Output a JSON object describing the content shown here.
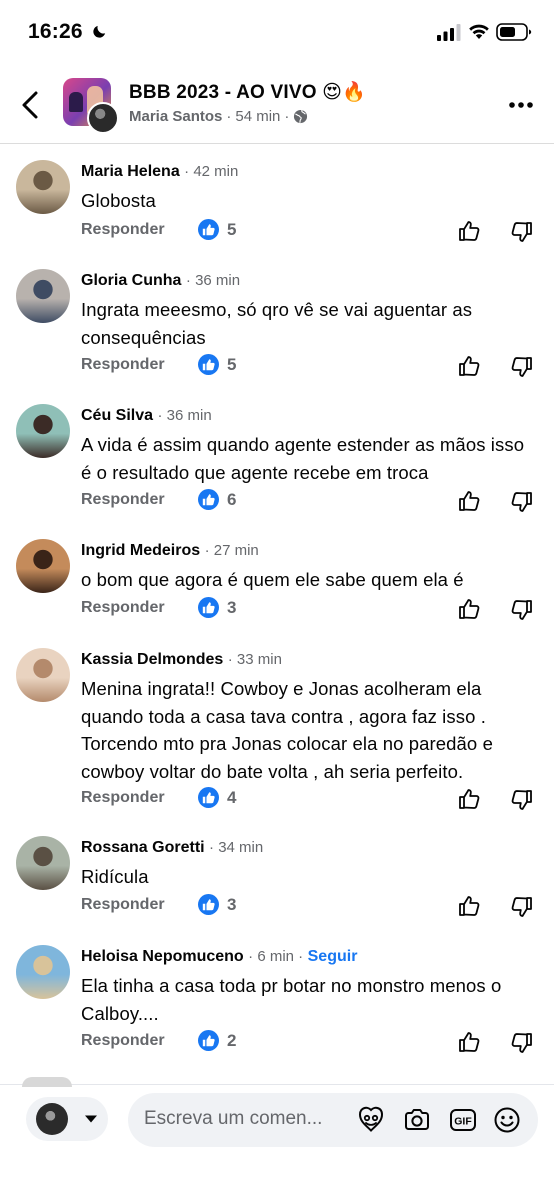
{
  "status_bar": {
    "time": "16:26"
  },
  "header": {
    "title": "BBB 2023 - AO VIVO 😍🔥",
    "author": "Maria Santos",
    "separator": "·",
    "time_ago": "54 min"
  },
  "comments": [
    {
      "name": "Maria Helena",
      "time": "· 42 min",
      "text": "Globosta",
      "reply": "Responder",
      "likes": "5",
      "avatar_colors": [
        "#c9b79c",
        "#6b5a45"
      ]
    },
    {
      "name": "Gloria Cunha",
      "time": "· 36 min",
      "text": "Ingrata meeesmo, só qro vê se vai aguentar as consequências",
      "reply": "Responder",
      "likes": "5",
      "avatar_colors": [
        "#b8b2ad",
        "#3f4c63"
      ]
    },
    {
      "name": "Céu Silva",
      "time": "· 36 min",
      "text": "A vida é assim quando agente estender as mãos isso é o resultado que agente recebe em troca",
      "reply": "Responder",
      "likes": "6",
      "avatar_colors": [
        "#8fbfb7",
        "#3b2b26"
      ]
    },
    {
      "name": "Ingrid Medeiros",
      "time": "· 27 min",
      "text": "o bom que agora é quem ele sabe quem ela é",
      "reply": "Responder",
      "likes": "3",
      "avatar_colors": [
        "#c48b5b",
        "#3a2418"
      ]
    },
    {
      "name": "Kassia Delmondes",
      "time": "· 33 min",
      "text": "Menina ingrata!! Cowboy e Jonas acolheram ela quando toda a casa tava contra , agora faz isso . Torcendo mto pra Jonas colocar ela no paredão e cowboy voltar do bate volta , ah seria perfeito.",
      "reply": "Responder",
      "likes": "4",
      "avatar_colors": [
        "#e9d3c0",
        "#b48a6c"
      ]
    },
    {
      "name": "Rossana Goretti",
      "time": "· 34 min",
      "text": "Ridícula",
      "reply": "Responder",
      "likes": "3",
      "avatar_colors": [
        "#a9b3a6",
        "#5a5044"
      ]
    },
    {
      "name": "Heloisa Nepomuceno",
      "time": "· 6 min ·",
      "follow": "Seguir",
      "text": "Ela tinha a casa toda pr botar no monstro menos o Calboy....",
      "reply": "Responder",
      "likes": "2",
      "avatar_colors": [
        "#7fb6dc",
        "#d8c39a"
      ]
    }
  ],
  "composer": {
    "placeholder": "Escreva um comen..."
  },
  "icons": {
    "moon": "moon-icon",
    "signal": "signal-icon",
    "wifi": "wifi-icon",
    "battery": "battery-icon",
    "back": "back-arrow-icon",
    "globe": "globe-icon",
    "more": "more-options-icon",
    "like": "like-thumb-icon",
    "upvote": "upvote-icon",
    "downvote": "downvote-icon",
    "avatar_frame": "avatar-frame-icon",
    "camera": "camera-icon",
    "gif": "gif-icon",
    "emoji": "emoji-icon"
  },
  "colors": {
    "accent": "#1877f2",
    "secondary_text": "#65676b",
    "primary_text": "#050505",
    "composer_bg": "#f0f2f5"
  }
}
